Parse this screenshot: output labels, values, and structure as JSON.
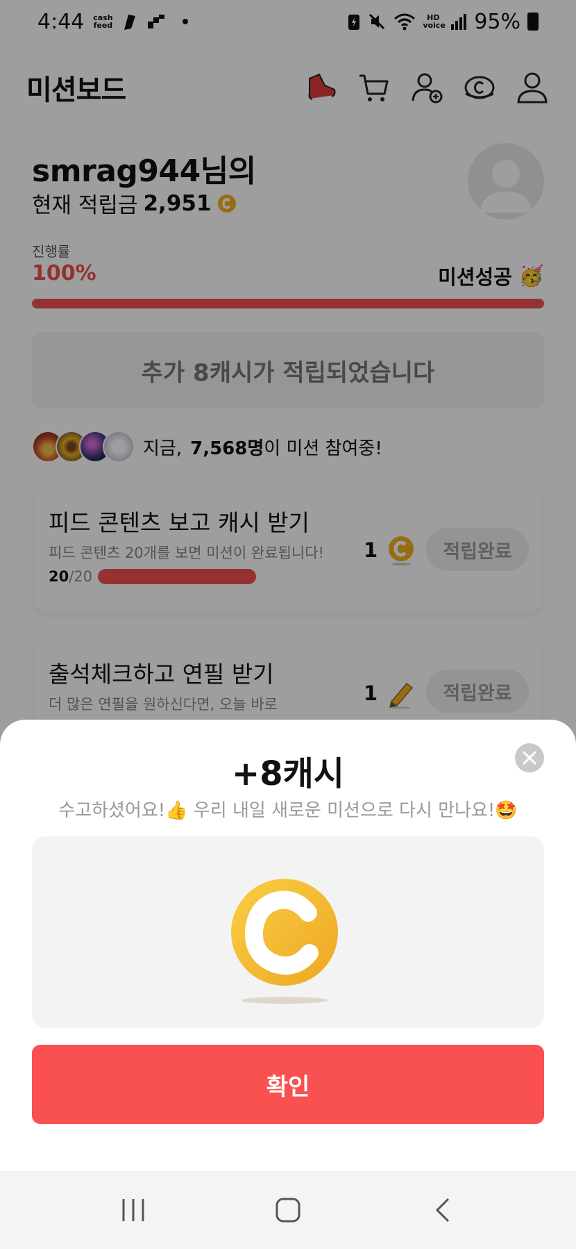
{
  "status_bar": {
    "time": "4:44",
    "app_badge": "cash feed",
    "battery": "95%",
    "hd_label": "HD voice"
  },
  "header": {
    "title": "미션보드",
    "icons": [
      "shoe-icon",
      "cart-icon",
      "add-friend-icon",
      "cash-coin-icon",
      "profile-icon"
    ]
  },
  "user": {
    "greeting": "smrag944님의",
    "balance_label": "현재 적립금",
    "balance_value": "2,951"
  },
  "progress": {
    "label": "진행률",
    "value": "100%",
    "fraction": 1.0,
    "success_label": "미션성공",
    "success_emoji": "🥳"
  },
  "notice": {
    "text": "추가 8캐시가 적립되었습니다"
  },
  "participants": {
    "prefix": "지금,",
    "count": "7,568명",
    "suffix": "이 미션 참여중!"
  },
  "missions": [
    {
      "title": "피드 콘텐츠 보고 캐시 받기",
      "description": "피드 콘텐츠 20개를 보면 미션이 완료됩니다!",
      "progress_done": "20",
      "progress_total": "/20",
      "reward": "1",
      "reward_icon": "cash-coin-icon",
      "button": "적립완료"
    },
    {
      "title": "출석체크하고 연필 받기",
      "description": "더 많은 연필을 원하신다면, 오늘 바로",
      "reward": "1",
      "reward_icon": "pencil-icon",
      "button": "적립완료"
    }
  ],
  "modal": {
    "title": "+8캐시",
    "message": "수고하셨어요!👍 우리 내일 새로운 미션으로 다시 만나요!🤩",
    "confirm_label": "확인"
  },
  "colors": {
    "accent": "#f95050",
    "coin": "#f2b01e"
  }
}
